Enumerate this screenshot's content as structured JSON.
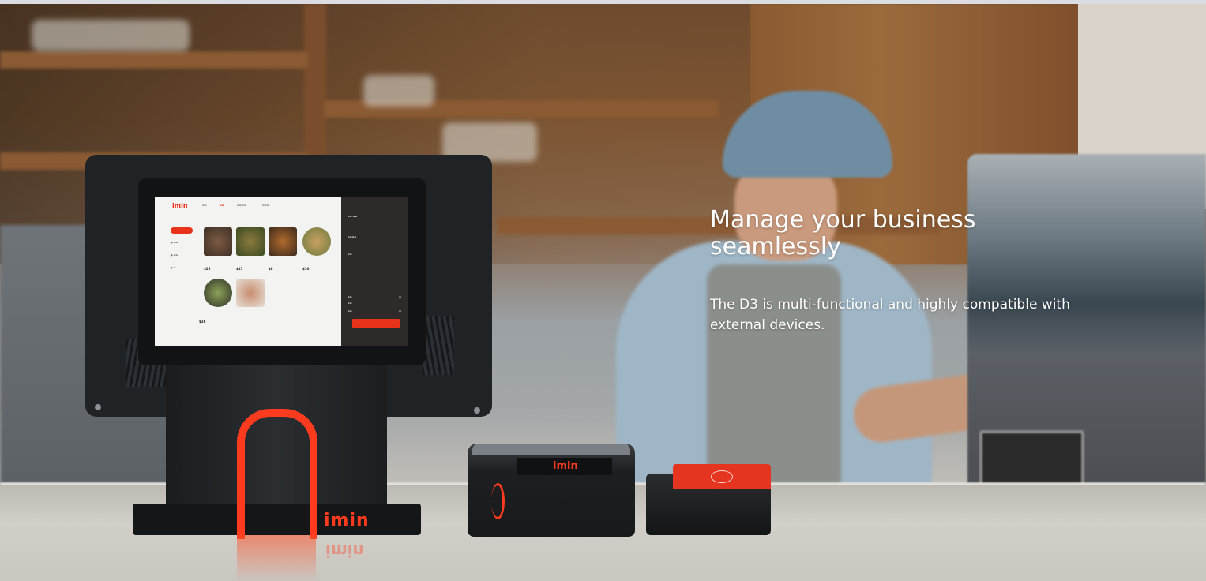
{
  "hero": {
    "title": "Manage your business seamlessly",
    "description": "The D3 is multi-functional and highly compatible with external devices."
  },
  "device": {
    "brand": "imin",
    "screen": {
      "logo": "imin",
      "nav_items": [
        "",
        "",
        "",
        ""
      ],
      "checkout_label": "",
      "prices": [
        "$25",
        "$17",
        "$8",
        "$10",
        "$26"
      ]
    }
  },
  "colors": {
    "brand_red": "#ff3b1f",
    "text": "#ffffff"
  }
}
